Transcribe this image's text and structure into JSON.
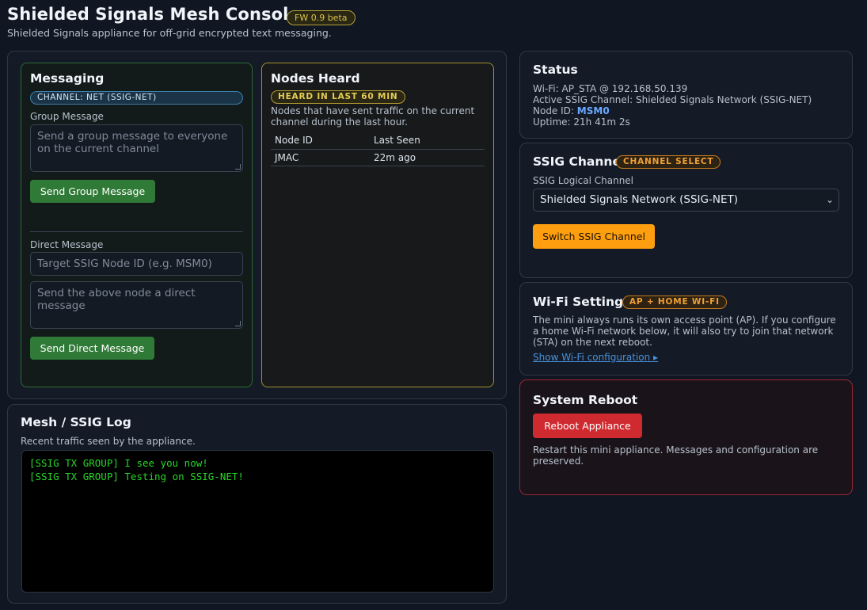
{
  "header": {
    "title": "Shielded Signals Mesh Console",
    "fw_badge": "FW 0.9 beta",
    "subtitle": "Shielded Signals appliance for off-grid encrypted text messaging."
  },
  "messaging": {
    "title": "Messaging",
    "channel_pill": "CHANNEL: NET (SSIG-NET)",
    "group_label": "Group Message",
    "group_placeholder": "Send a group message to everyone on the current channel",
    "group_button": "Send Group Message",
    "direct_label": "Direct Message",
    "target_placeholder": "Target SSIG Node ID (e.g. MSM0)",
    "direct_placeholder": "Send the above node a direct message",
    "direct_button": "Send Direct Message"
  },
  "nodes_heard": {
    "title": "Nodes Heard",
    "pill": "HEARD IN LAST 60 MIN",
    "description": "Nodes that have sent traffic on the current channel during the last hour.",
    "columns": [
      "Node ID",
      "Last Seen"
    ],
    "rows": [
      {
        "node_id": "JMAC",
        "last_seen": "22m ago"
      }
    ]
  },
  "log": {
    "title": "Mesh / SSIG Log",
    "subtitle": "Recent traffic seen by the appliance.",
    "lines": [
      "[SSIG TX GROUP] I see you now!",
      "[SSIG TX GROUP] Testing on SSIG-NET!"
    ]
  },
  "status": {
    "title": "Status",
    "wifi_label": "Wi-Fi:",
    "wifi_value": "AP_STA @ 192.168.50.139",
    "channel_label": "Active SSIG Channel:",
    "channel_value": "Shielded Signals Network (SSIG-NET)",
    "node_label": "Node ID:",
    "node_value": "MSM0",
    "uptime_label": "Uptime:",
    "uptime_value": "21h 41m 2s"
  },
  "ssig_channel": {
    "title": "SSIG Channel",
    "pill": "CHANNEL SELECT",
    "select_label": "SSIG Logical Channel",
    "selected": "Shielded Signals Network (SSIG-NET)",
    "button": "Switch SSIG Channel"
  },
  "wifi": {
    "title": "Wi-Fi Settings",
    "pill": "AP + HOME WI-FI",
    "description": "The mini always runs its own access point (AP). If you configure a home Wi-Fi network below, it will also try to join that network (STA) on the next reboot.",
    "link": "Show Wi-Fi configuration ▸"
  },
  "reboot": {
    "title": "System Reboot",
    "button": "Reboot Appliance",
    "description": "Restart this mini appliance. Messages and configuration are preserved."
  },
  "colors": {
    "background": "#101722",
    "accent_green": "#2f7a36",
    "accent_orange": "#ff9f0f",
    "accent_red": "#cf2a2f",
    "log_text": "#27d627"
  }
}
